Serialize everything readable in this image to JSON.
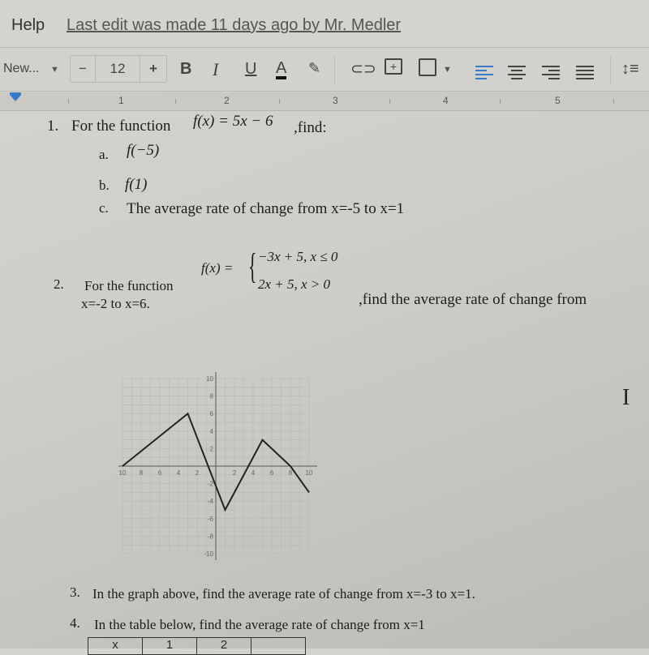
{
  "menubar": {
    "help_label": "Help",
    "last_edit": "Last edit was made 11 days ago by Mr. Medler"
  },
  "toolbar": {
    "font_name": "New...",
    "font_size": "12",
    "decrease_label": "−",
    "increase_label": "+",
    "bold_label": "B",
    "italic_label": "I",
    "underline_label": "U",
    "text_color_label": "A",
    "text_color": "#111111",
    "icons": [
      "highlight-pen-icon",
      "link-icon",
      "add-comment-icon",
      "insert-image-icon",
      "align-left-icon",
      "align-center-icon",
      "align-right-icon",
      "justify-icon",
      "line-spacing-icon"
    ],
    "active_align_color": "#3a78c9"
  },
  "ruler": {
    "labels": [
      "1",
      "2",
      "3",
      "4",
      "5"
    ]
  },
  "questions": {
    "q1": {
      "number": "1.",
      "text": "For the function",
      "function": "f(x) = 5x − 6",
      "suffix": ",find:",
      "parts": [
        {
          "label": "a.",
          "text": "f(−5)"
        },
        {
          "label": "b.",
          "text": "f(1)"
        },
        {
          "label": "c.",
          "text": "The average rate of change from x=-5 to x=1"
        }
      ]
    },
    "q2": {
      "number": "2.",
      "text": "For the function",
      "function_lhs": "f(x) =",
      "case1": "−3x + 5, x ≤ 0",
      "case2": "2x + 5, x > 0",
      "suffix": ",find the average rate of change from",
      "continuation": "x=-2 to x=6."
    },
    "q3": {
      "number": "3.",
      "text": "In the graph above, find the average rate of change from x=-3 to x=1."
    },
    "q4": {
      "number": "4.",
      "text": "In the table below, find the average rate of change from x=1",
      "table_header": [
        "x",
        "1",
        "2",
        ""
      ]
    }
  },
  "chart_data": {
    "type": "line",
    "title": "",
    "xlabel": "",
    "ylabel": "",
    "xlim": [
      -10,
      10
    ],
    "ylim": [
      -10,
      10
    ],
    "grid": true,
    "x_ticks": [
      -10,
      -8,
      -6,
      -4,
      -2,
      2,
      4,
      6,
      8,
      10
    ],
    "y_ticks": [
      10,
      8,
      6,
      4,
      2,
      -2,
      -4,
      -6,
      -8,
      -10
    ],
    "series": [
      {
        "name": "f",
        "x": [
          -10,
          -3,
          1,
          5,
          8,
          10
        ],
        "y": [
          0,
          6,
          -5,
          3,
          0,
          -3
        ]
      }
    ]
  },
  "cursor": {
    "icon": "text-cursor-icon",
    "glyph": "I"
  }
}
